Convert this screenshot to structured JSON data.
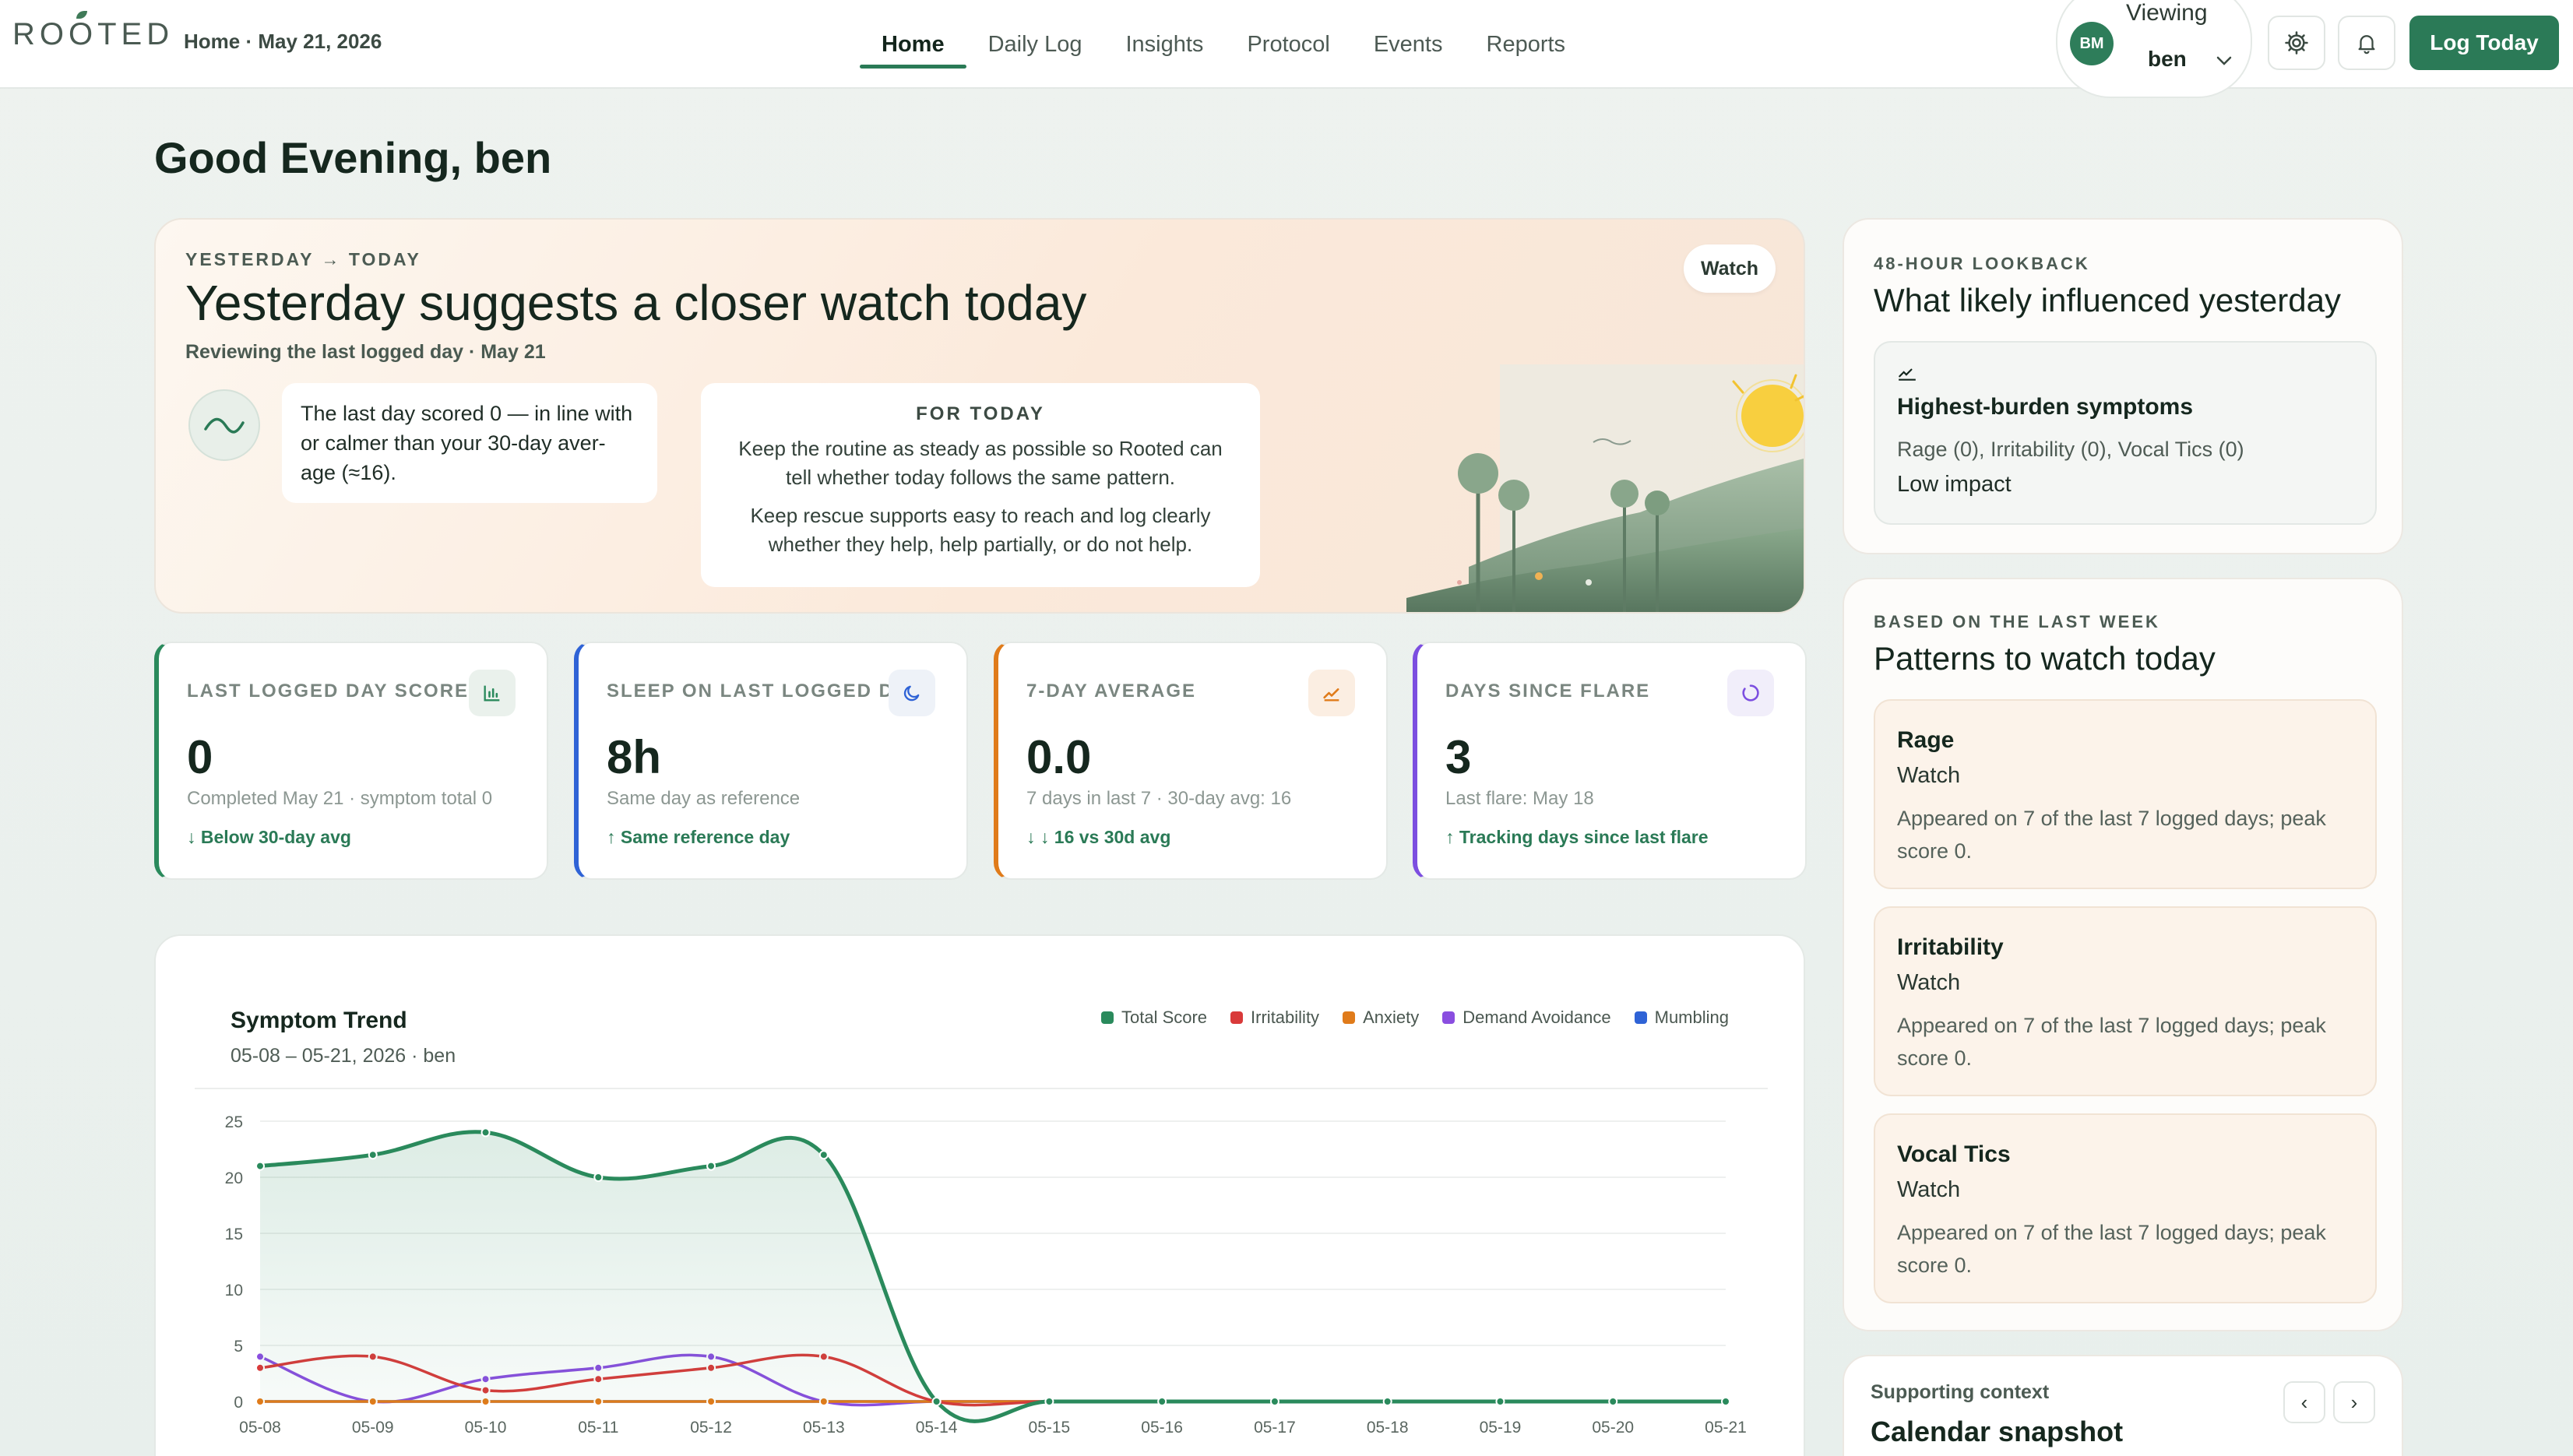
{
  "nav": {
    "logo": "ROOTED",
    "breadcrumb": "Home · May 21, 2026",
    "tabs": [
      {
        "label": "Home",
        "active": true
      },
      {
        "label": "Daily Log",
        "active": false
      },
      {
        "label": "Insights",
        "active": false
      },
      {
        "label": "Protocol",
        "active": false
      },
      {
        "label": "Events",
        "active": false
      },
      {
        "label": "Reports",
        "active": false
      }
    ],
    "viewer": {
      "avatar": "BM",
      "label": "Viewing",
      "name": "ben"
    },
    "settings_icon": "gear-icon",
    "notifications_icon": "bell-icon",
    "log_button": "Log Today"
  },
  "greeting": "Good Evening, ben",
  "hero": {
    "eyebrow": "YESTERDAY → TODAY",
    "title": "Yesterday suggests a closer watch today",
    "subtitle": "Reviewing the last logged day · May 21",
    "badge": "Watch",
    "summary": "The last day scored 0 — in line with or calmer than your 30-day aver-age (≈16).",
    "for_today": {
      "heading": "FOR TODAY",
      "lines": [
        "Keep the routine as steady as possible so Rooted can tell whether today follows the same pattern.",
        "Keep rescue supports easy to reach and log clearly whether they help, help partially, or do not help."
      ]
    }
  },
  "stats": [
    {
      "label": "LAST LOGGED DAY SCORE",
      "value": "0",
      "sub": "Completed May 21 · symptom total 0",
      "delta": "Below 30-day avg",
      "delta_arrow": "down",
      "color": "#2a8a5c",
      "icon": "bar-chart-icon"
    },
    {
      "label": "SLEEP ON LAST LOGGED DAY",
      "value": "8h",
      "sub": "Same day as reference",
      "delta": "Same reference day",
      "delta_arrow": "up",
      "color": "#2f63d6",
      "icon": "moon-icon"
    },
    {
      "label": "7-DAY AVERAGE",
      "value": "0.0",
      "sub": "7 days in last 7 · 30-day avg: 16",
      "delta": "↓ 16 vs 30d avg",
      "delta_arrow": "down",
      "color": "#e07b1a",
      "icon": "trend-icon"
    },
    {
      "label": "DAYS SINCE FLARE",
      "value": "3",
      "sub": "Last flare: May 18",
      "delta": "Tracking days since last flare",
      "delta_arrow": "up",
      "color": "#7c4ee0",
      "icon": "refresh-icon"
    }
  ],
  "chart": {
    "title": "Symptom Trend",
    "subtitle": "05-08 – 05-21, 2026 · ben"
  },
  "chart_data": {
    "type": "line",
    "x": [
      "05-08",
      "05-09",
      "05-10",
      "05-11",
      "05-12",
      "05-13",
      "05-14",
      "05-15",
      "05-16",
      "05-17",
      "05-18",
      "05-19",
      "05-20",
      "05-21"
    ],
    "ylim": [
      0,
      25
    ],
    "yticks": [
      0,
      5,
      10,
      15,
      20,
      25
    ],
    "grid": true,
    "legend_position": "top-right",
    "series": [
      {
        "name": "Total Score",
        "color": "#2a8a5c",
        "values": [
          21,
          22,
          24,
          20,
          21,
          22,
          0,
          0,
          0,
          0,
          0,
          0,
          0,
          0
        ]
      },
      {
        "name": "Irritability",
        "color": "#d93a3a",
        "values": [
          3,
          4,
          1,
          2,
          3,
          4,
          0,
          0,
          0,
          0,
          0,
          0,
          0,
          0
        ]
      },
      {
        "name": "Anxiety",
        "color": "#e07b1a",
        "values": [
          0,
          0,
          0,
          0,
          0,
          0,
          0,
          0,
          0,
          0,
          0,
          0,
          0,
          0
        ]
      },
      {
        "name": "Demand Avoidance",
        "color": "#8a4ee0",
        "values": [
          4,
          0,
          2,
          3,
          4,
          0,
          0,
          0,
          0,
          0,
          0,
          0,
          0,
          0
        ]
      },
      {
        "name": "Mumbling",
        "color": "#2f63d6",
        "values": [
          0,
          0,
          0,
          0,
          0,
          0,
          0,
          0,
          0,
          0,
          0,
          0,
          0,
          0
        ]
      }
    ]
  },
  "lookback": {
    "eyebrow": "48-HOUR LOOKBACK",
    "title": "What likely influenced yesterday",
    "heading": "Highest-burden symptoms",
    "symptoms": "Rage (0), Irritability (0), Vocal Tics (0)",
    "impact": "Low impact"
  },
  "patterns": {
    "eyebrow": "BASED ON THE LAST WEEK",
    "title": "Patterns to watch today",
    "items": [
      {
        "name": "Rage",
        "level": "Watch",
        "desc": "Appeared on 7 of the last 7 logged days; peak score 0."
      },
      {
        "name": "Irritability",
        "level": "Watch",
        "desc": "Appeared on 7 of the last 7 logged days; peak score 0."
      },
      {
        "name": "Vocal Tics",
        "level": "Watch",
        "desc": "Appeared on 7 of the last 7 logged days; peak score 0."
      }
    ]
  },
  "calendar": {
    "eyebrow": "Supporting context",
    "title": "Calendar snapshot"
  }
}
